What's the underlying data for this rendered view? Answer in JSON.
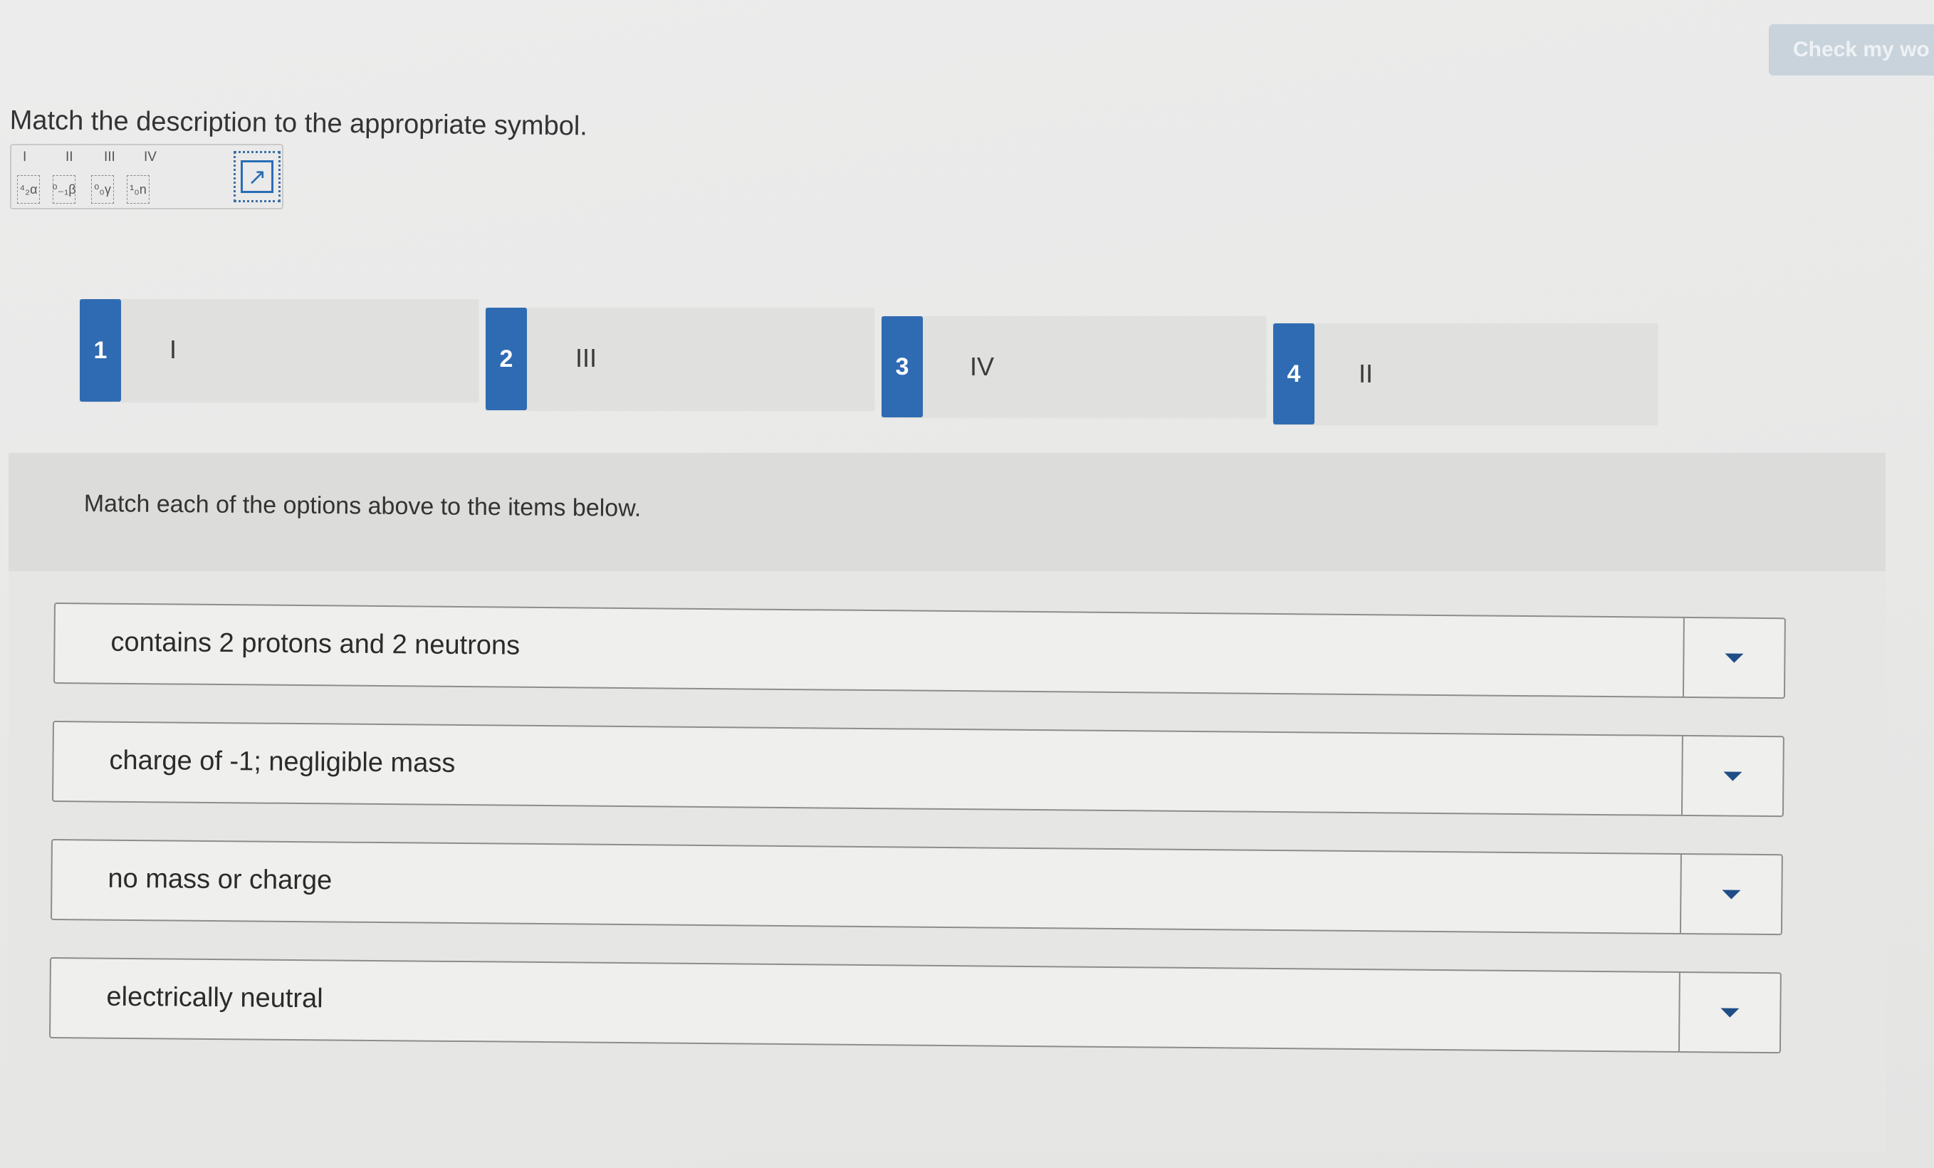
{
  "header": {
    "check_button_label": "Check my wo"
  },
  "question": {
    "prompt": "Match the description to the appropriate symbol."
  },
  "symbol_image": {
    "roman_labels": [
      "I",
      "II",
      "III",
      "IV"
    ],
    "symbols": [
      "⁴₂α",
      "⁰₋₁β",
      "⁰₀γ",
      "¹₀n"
    ]
  },
  "options": [
    {
      "number": "1",
      "label": "I"
    },
    {
      "number": "2",
      "label": "III"
    },
    {
      "number": "3",
      "label": "IV"
    },
    {
      "number": "4",
      "label": "II"
    }
  ],
  "match_section": {
    "instruction": "Match each of the options above to the items below.",
    "items": [
      {
        "text": "contains 2 protons and 2 neutrons",
        "selected": ""
      },
      {
        "text": "charge of -1; negligible mass",
        "selected": ""
      },
      {
        "text": "no mass or charge",
        "selected": ""
      },
      {
        "text": "electrically neutral",
        "selected": ""
      }
    ]
  },
  "colors": {
    "accent": "#2f6bb2",
    "dropdown_caret": "#1f4e86",
    "disabled_button": "#c9d3dc"
  }
}
